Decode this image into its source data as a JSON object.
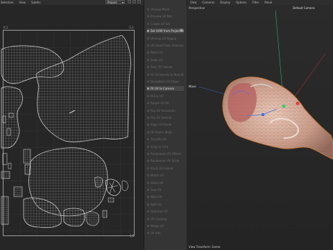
{
  "uv_editor": {
    "menu": [
      "Selection",
      "View",
      "Subdiv"
    ],
    "project_select": "Project",
    "corner_tl": "0,1",
    "corner_tr": "1,1",
    "corner_br": "1,0"
  },
  "side_panel": {
    "items": [
      {
        "label": "Unwrap Mesh",
        "highlight": false
      },
      {
        "label": "Preview UV Net",
        "highlight": false
      },
      {
        "label": "Create UV Set",
        "highlight": false
      },
      {
        "label": "Set UVW from Projection",
        "highlight": true,
        "gear": "⚙"
      },
      {
        "label": "Unwrap UV Region",
        "highlight": false
      },
      {
        "label": "UV Island from Selection",
        "highlight": false
      },
      {
        "label": "Relax UV",
        "highlight": false
      },
      {
        "label": "Scale UV",
        "highlight": false
      },
      {
        "label": "Pack UV Islands",
        "highlight": false
      },
      {
        "label": "Fit UV Islands to Bounding",
        "highlight": false
      },
      {
        "label": "Straighten UV Edges",
        "highlight": false
      },
      {
        "label": "Fit UV to Camera",
        "highlight": true
      },
      {
        "label": "Mirror UV",
        "highlight": false
      },
      {
        "label": "Rotate UV 90",
        "highlight": false
      },
      {
        "label": "Flip UV Horizontal",
        "highlight": false
      },
      {
        "label": "Flip UV Vertical",
        "highlight": false
      },
      {
        "label": "Align UV Points",
        "highlight": false
      },
      {
        "label": "UV Peeler Weld",
        "highlight": false
      },
      {
        "label": "Transfer UV",
        "highlight": false
      },
      {
        "label": "Snap to Grid",
        "highlight": false
      },
      {
        "label": "Randomize UV Offsets",
        "highlight": false
      },
      {
        "label": "Randomize UV Scale",
        "highlight": false
      },
      {
        "label": "Stack UV Islands",
        "highlight": false
      },
      {
        "label": "Match UV",
        "highlight": false
      },
      {
        "label": "Stitch UV",
        "highlight": false
      },
      {
        "label": "Sew UV",
        "highlight": false
      },
      {
        "label": "Weld UV",
        "highlight": false
      },
      {
        "label": "Split UV",
        "highlight": false
      },
      {
        "label": "Optimize UV",
        "highlight": false
      },
      {
        "label": "UV Cleanup",
        "highlight": false
      },
      {
        "label": "Merge UV",
        "highlight": false
      },
      {
        "label": "UV Info",
        "highlight": false
      }
    ]
  },
  "viewport": {
    "menu": [
      "View",
      "Cameras",
      "Display",
      "Options",
      "Filter",
      "Panel"
    ],
    "perspective": "Perspective",
    "camera": "Default Camera",
    "move_label": "Move",
    "status": "View Transform: Scene"
  }
}
